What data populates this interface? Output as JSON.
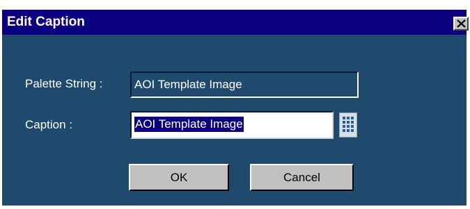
{
  "dialog": {
    "title": "Edit Caption",
    "close_icon": "close-icon"
  },
  "form": {
    "palette_label": "Palette String :",
    "palette_value": "AOI Template Image",
    "caption_label": "Caption :",
    "caption_value": "AOI Template Image",
    "caption_selected": true,
    "picker_icon": "keypad-grid-icon"
  },
  "buttons": {
    "ok_label": "OK",
    "cancel_label": "Cancel"
  },
  "colors": {
    "titlebar": "#0d0080",
    "panel": "#1f4a6d",
    "selection": "#0d0080",
    "button_face": "#c0c0c0"
  }
}
